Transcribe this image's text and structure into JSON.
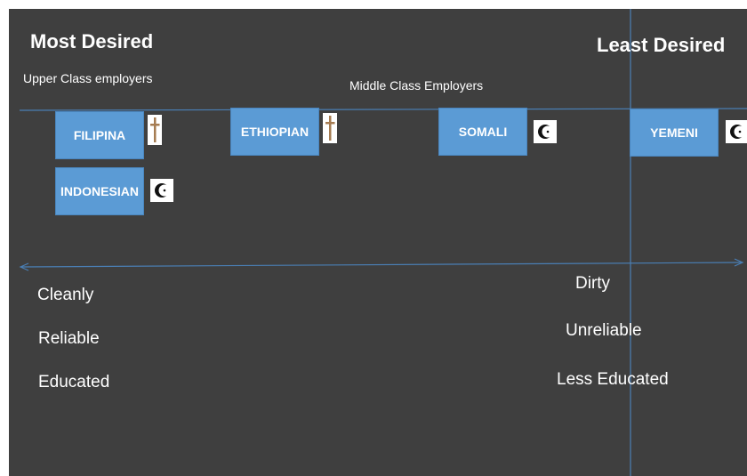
{
  "titles": {
    "most_desired": "Most Desired",
    "least_desired": "Least Desired"
  },
  "employer_labels": {
    "upper": "Upper Class employers",
    "middle": "Middle Class Employers"
  },
  "nationalities": {
    "filipina": {
      "label": "FILIPINA",
      "religion_icon": "cross-icon"
    },
    "indonesian": {
      "label": "INDONESIAN",
      "religion_icon": "crescent-icon"
    },
    "ethiopian": {
      "label": "ETHIOPIAN",
      "religion_icon": "cross-icon"
    },
    "somali": {
      "label": "SOMALI",
      "religion_icon": "crescent-icon"
    },
    "yemeni": {
      "label": "YEMENI",
      "religion_icon": "crescent-icon"
    }
  },
  "traits": {
    "positive": [
      "Cleanly",
      "Reliable",
      "Educated"
    ],
    "negative": [
      "Dirty",
      "Unreliable",
      "Less Educated"
    ]
  },
  "colors": {
    "background": "#3f3f3f",
    "box": "#5b9bd5",
    "line": "#4a7fb5",
    "cross": "#a67c52"
  }
}
